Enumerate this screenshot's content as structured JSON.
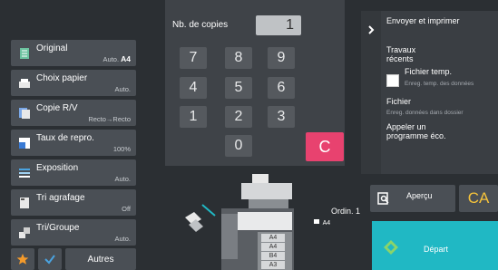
{
  "left_menu": [
    {
      "name": "original",
      "label": "Original",
      "value_prefix": "Auto.",
      "value_bold": "A4",
      "icon": "document-icon"
    },
    {
      "name": "choix-papier",
      "label": "Choix papier",
      "value": "Auto.",
      "icon": "paper-tray-icon"
    },
    {
      "name": "copie-rv",
      "label": "Copie R/V",
      "value": "Recto→Recto",
      "icon": "duplex-icon"
    },
    {
      "name": "taux-repro",
      "label": "Taux de repro.",
      "value": "100%",
      "icon": "zoom-ratio-icon"
    },
    {
      "name": "exposition",
      "label": "Exposition",
      "value": "Auto.",
      "icon": "exposure-icon"
    },
    {
      "name": "tri-agrafage",
      "label": "Tri agrafage",
      "value": "Off",
      "icon": "staple-icon"
    },
    {
      "name": "tri-groupe",
      "label": "Tri/Groupe",
      "value": "Auto.",
      "icon": "sort-group-icon"
    }
  ],
  "bottom_bar": {
    "autres_label": "Autres"
  },
  "keypad": {
    "copies_label": "Nb. de copies",
    "copies_value": "1",
    "keys": [
      "7",
      "8",
      "9",
      "4",
      "5",
      "6",
      "1",
      "2",
      "3",
      "0"
    ],
    "clear_label": "C"
  },
  "right_panel": {
    "envoyer": "Envoyer et imprimer",
    "travaux_line1": "Travaux",
    "travaux_line2": "récents",
    "fichier_temp": "Fichier temp.",
    "fichier_temp_sub": "Enreg. temp. des données",
    "fichier": "Fichier",
    "fichier_sub": "Enreg. données dans dossier",
    "appeler_line1": "Appeler un",
    "appeler_line2": "programme éco."
  },
  "actions": {
    "apercu_label": "Aperçu",
    "ca_label": "CA",
    "depart_label": "Départ"
  },
  "machine": {
    "ordin_label": "Ordin. 1",
    "ordin_paper": "A4",
    "tray_labels": [
      "A4",
      "A4",
      "B4",
      "A3"
    ]
  },
  "colors": {
    "background": "#2b2f33",
    "clear_key": "#e8426f",
    "depart": "#20b8c4",
    "ca_text": "#f5c33b",
    "accent_blue": "#4aa3e0"
  }
}
